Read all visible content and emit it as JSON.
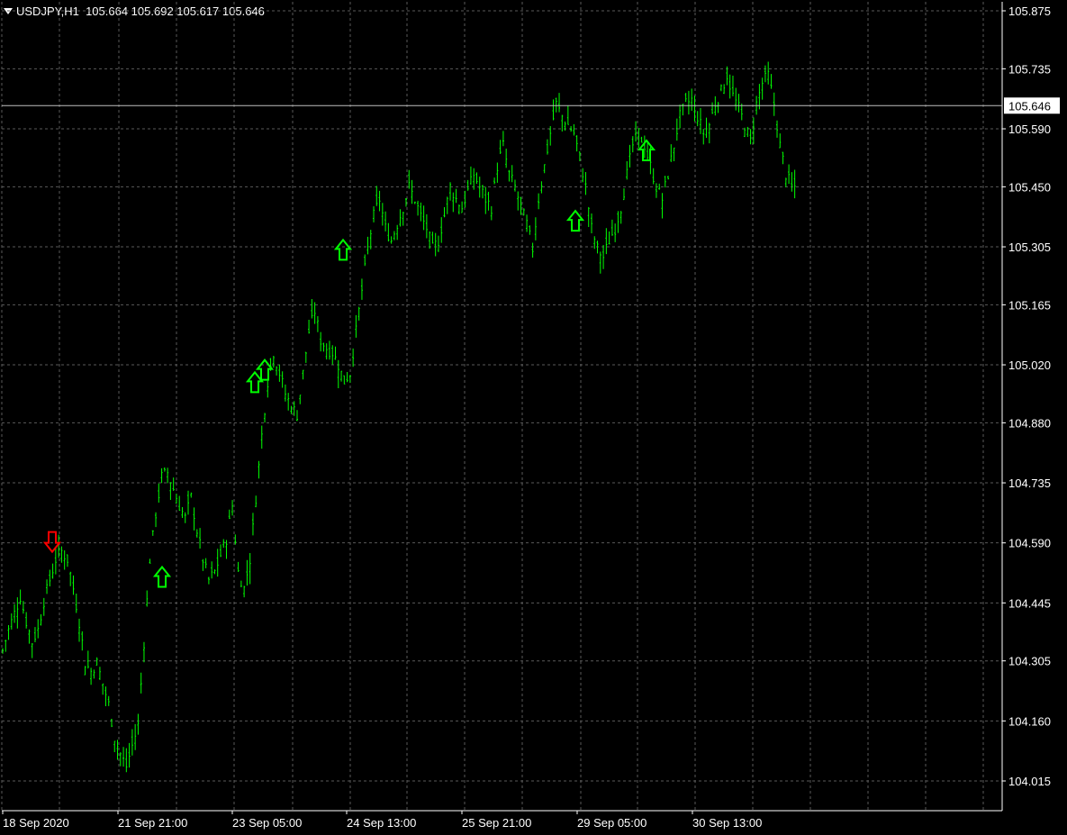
{
  "header": {
    "symbol": "USDJPY,H1",
    "ohlc": "105.664 105.692 105.617 105.646"
  },
  "colors": {
    "background": "#000000",
    "grid": "#5a5a5a",
    "axis": "#ffffff",
    "bars": "#00ff00",
    "buy_arrow": "#00ff00",
    "sell_arrow": "#ff0000",
    "price_line": "#c0c0c0"
  },
  "chart_data": {
    "type": "line",
    "title": "USDJPY,H1",
    "ylim": [
      104.0,
      105.9
    ],
    "y_ticks": [
      105.875,
      105.735,
      105.59,
      105.45,
      105.305,
      105.165,
      105.02,
      104.88,
      104.735,
      104.59,
      104.445,
      104.305,
      104.16,
      104.015
    ],
    "y_tick_labels": [
      "105.875",
      "105.735",
      "105.590",
      "105.450",
      "105.305",
      "105.165",
      "105.020",
      "104.880",
      "104.735",
      "104.590",
      "104.445",
      "104.305",
      "104.160",
      "104.015"
    ],
    "x_tick_labels": [
      "18 Sep 2020",
      "21 Sep 21:00",
      "23 Sep 05:00",
      "24 Sep 13:00",
      "25 Sep 21:00",
      "29 Sep 05:00",
      "30 Sep 13:00"
    ],
    "bar_count": 135,
    "last_price": 105.646,
    "last_price_label": "105.646",
    "series": [
      {
        "values": [
          104.33,
          104.38,
          104.42,
          104.46,
          104.4,
          104.35,
          104.38,
          104.45,
          104.5,
          104.55,
          104.57,
          104.55,
          104.48,
          104.4,
          104.3,
          104.28,
          104.3,
          104.25,
          104.2,
          104.12,
          104.08,
          104.05,
          104.1,
          104.15,
          104.35,
          104.55,
          104.66,
          104.75,
          104.76,
          104.72,
          104.68,
          104.65,
          104.7,
          104.62,
          104.55,
          104.5,
          104.52,
          104.56,
          104.6,
          104.68,
          104.52,
          104.48,
          104.55,
          104.7,
          104.85,
          104.98,
          105.05,
          105.0,
          104.95,
          104.92,
          104.9,
          105.0,
          105.1,
          105.15,
          105.08,
          105.06,
          105.05,
          105.02,
          104.98,
          105.0,
          105.1,
          105.2,
          105.3,
          105.38,
          105.42,
          105.35,
          105.32,
          105.36,
          105.4,
          105.45,
          105.42,
          105.38,
          105.35,
          105.3,
          105.32,
          105.38,
          105.45,
          105.42,
          105.4,
          105.44,
          105.48,
          105.45,
          105.42,
          105.4,
          105.5,
          105.55,
          105.48,
          105.45,
          105.4,
          105.36,
          105.3,
          105.42,
          105.5,
          105.58,
          105.65,
          105.62,
          105.6,
          105.58,
          105.52,
          105.45,
          105.35,
          105.3,
          105.28,
          105.32,
          105.35,
          105.4,
          105.48,
          105.55,
          105.58,
          105.55,
          105.5,
          105.45,
          105.42,
          105.48,
          105.55,
          105.62,
          105.65,
          105.66,
          105.62,
          105.58,
          105.6,
          105.65,
          105.68,
          105.72,
          105.67,
          105.64,
          105.6,
          105.56,
          105.65,
          105.7,
          105.72,
          105.65,
          105.55,
          105.48,
          105.45
        ]
      }
    ],
    "signals": [
      {
        "type": "sell",
        "bar": 14,
        "price": 104.59
      },
      {
        "type": "buy",
        "bar": 44,
        "price": 104.51
      },
      {
        "type": "buy",
        "bar": 71,
        "price": 104.98
      },
      {
        "type": "buy",
        "bar": 74,
        "price": 105.01
      },
      {
        "type": "buy",
        "bar": 95,
        "price": 105.3
      },
      {
        "type": "buy",
        "bar": 159,
        "price": 105.37
      },
      {
        "type": "buy",
        "bar": 179,
        "price": 105.54
      }
    ]
  }
}
